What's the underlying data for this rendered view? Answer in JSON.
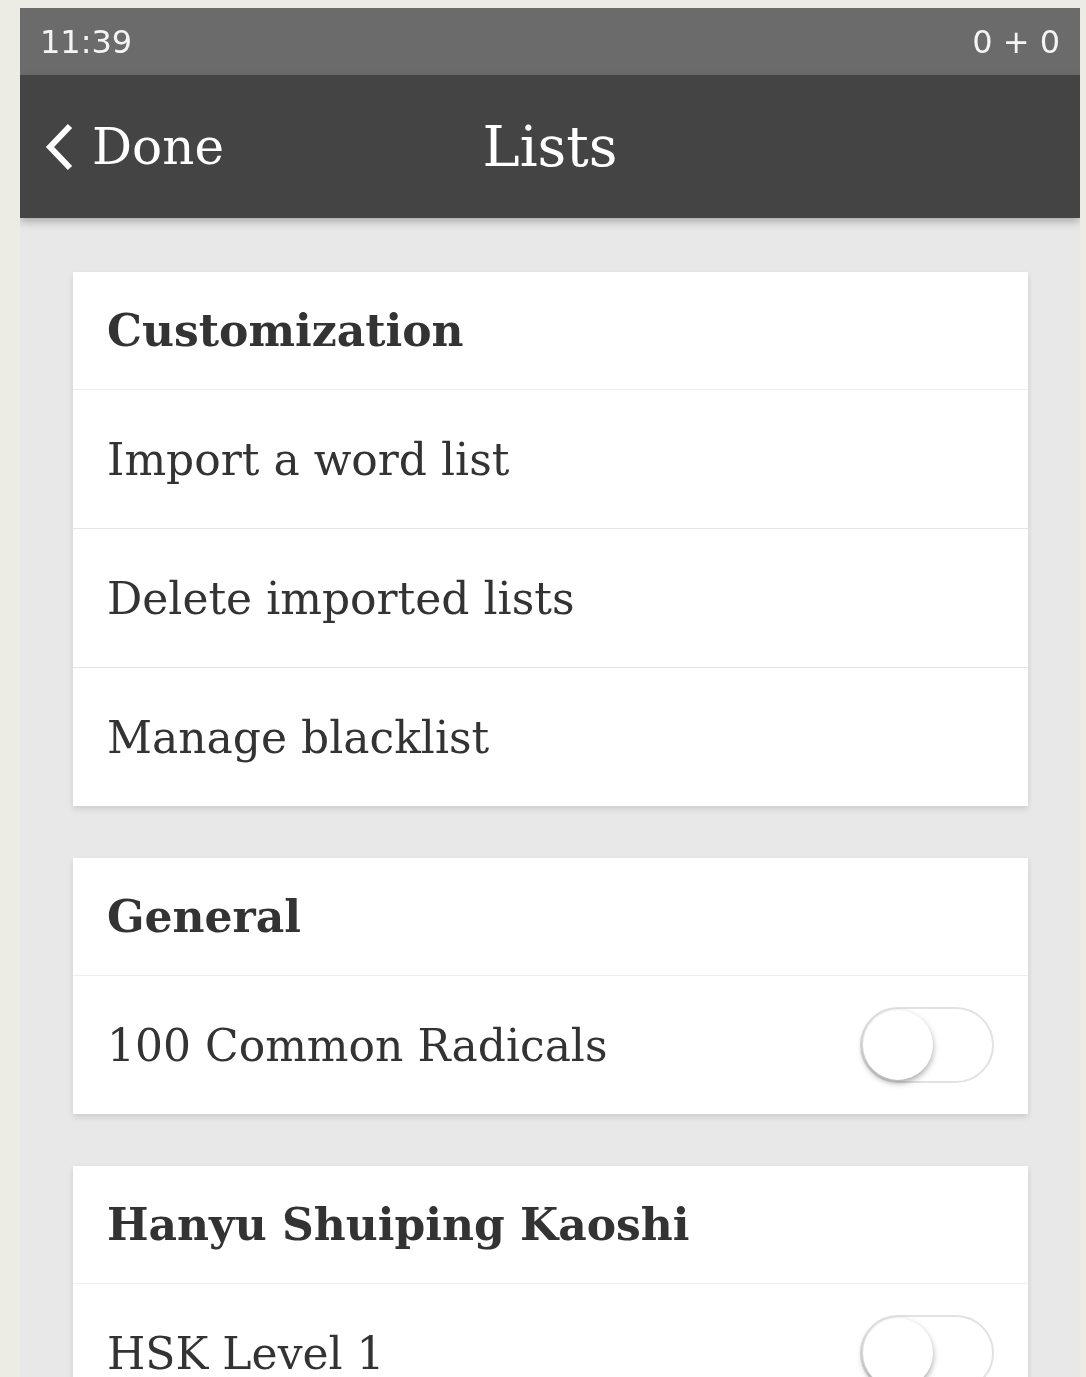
{
  "status_bar": {
    "time": "11:39",
    "counter": "0 + 0"
  },
  "nav_bar": {
    "back": "Done",
    "title": "Lists"
  },
  "sections": [
    {
      "title": "Customization",
      "items": [
        {
          "kind": "link",
          "label": "Import a word list"
        },
        {
          "kind": "link",
          "label": "Delete imported lists"
        },
        {
          "kind": "link",
          "label": "Manage blacklist"
        }
      ]
    },
    {
      "title": "General",
      "items": [
        {
          "kind": "toggle",
          "label": "100 Common Radicals",
          "on": false
        }
      ]
    },
    {
      "title": "Hanyu Shuiping Kaoshi",
      "items": [
        {
          "kind": "toggle",
          "label": "HSK Level 1",
          "on": false
        }
      ]
    }
  ]
}
